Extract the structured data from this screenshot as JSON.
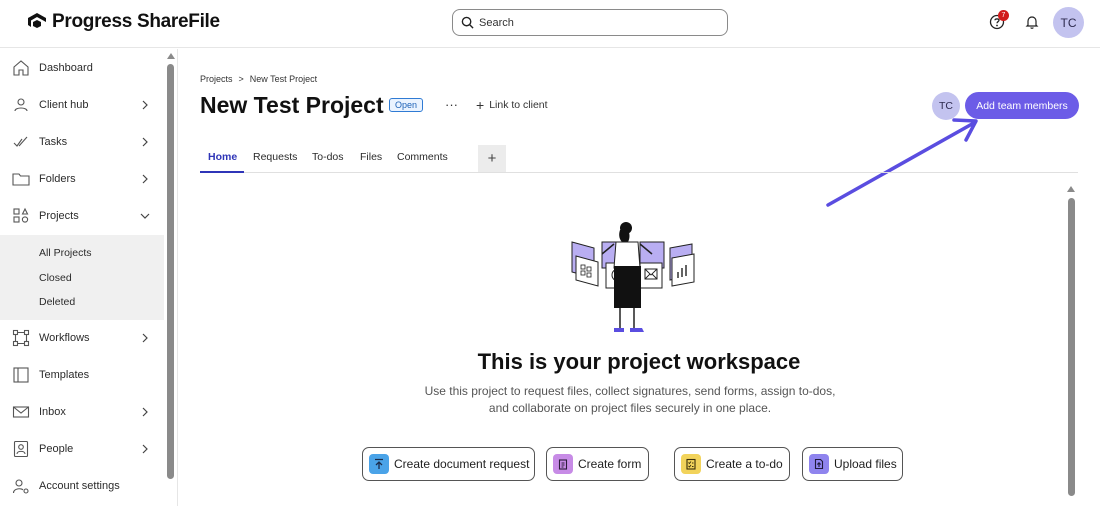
{
  "header": {
    "logo_text": "Progress ShareFile",
    "search_placeholder": "Search",
    "help_badge": "7",
    "user_initials": "TC"
  },
  "sidebar": {
    "items": [
      {
        "label": "Dashboard",
        "icon": "home-icon",
        "chevron": false
      },
      {
        "label": "Client hub",
        "icon": "client-hub-icon",
        "chevron": true
      },
      {
        "label": "Tasks",
        "icon": "tasks-check-icon",
        "chevron": true
      },
      {
        "label": "Folders",
        "icon": "folder-icon",
        "chevron": true
      },
      {
        "label": "Projects",
        "icon": "projects-shapes-icon",
        "chevron": true,
        "expanded": true
      },
      {
        "label": "Workflows",
        "icon": "workflows-icon",
        "chevron": true
      },
      {
        "label": "Templates",
        "icon": "templates-icon",
        "chevron": false
      },
      {
        "label": "Inbox",
        "icon": "inbox-mail-icon",
        "chevron": true
      },
      {
        "label": "People",
        "icon": "people-icon",
        "chevron": true
      },
      {
        "label": "Account settings",
        "icon": "account-settings-icon",
        "chevron": false
      }
    ],
    "project_subitems": [
      "All Projects",
      "Closed",
      "Deleted"
    ]
  },
  "breadcrumb": {
    "parent": "Projects",
    "separator": ">",
    "current": "New Test Project"
  },
  "project": {
    "title": "New Test Project",
    "status": "Open",
    "more_label": "···",
    "link_client": "Link to client",
    "member_initials": "TC",
    "add_team_label": "Add team members"
  },
  "tabs": [
    "Home",
    "Requests",
    "To-dos",
    "Files",
    "Comments"
  ],
  "tab_add": "+",
  "workspace": {
    "title": "This is your project workspace",
    "description": "Use this project to request files, collect signatures, send forms, assign to-dos, and collaborate on project files securely in one place."
  },
  "actions": [
    {
      "label": "Create document request",
      "icon": "upload-arrow-icon",
      "icon_bg": "#4aa3e8"
    },
    {
      "label": "Create form",
      "icon": "clipboard-icon",
      "icon_bg": "#c78be6"
    },
    {
      "label": "Create a to-do",
      "icon": "checklist-icon",
      "icon_bg": "#f2d35b"
    },
    {
      "label": "Upload files",
      "icon": "file-upload-icon",
      "icon_bg": "#8f84ee"
    }
  ],
  "colors": {
    "accent": "#6c5ce7",
    "active_tab": "#2f35b8",
    "status_border": "#2f7bd4",
    "badge": "#d11b1b"
  }
}
